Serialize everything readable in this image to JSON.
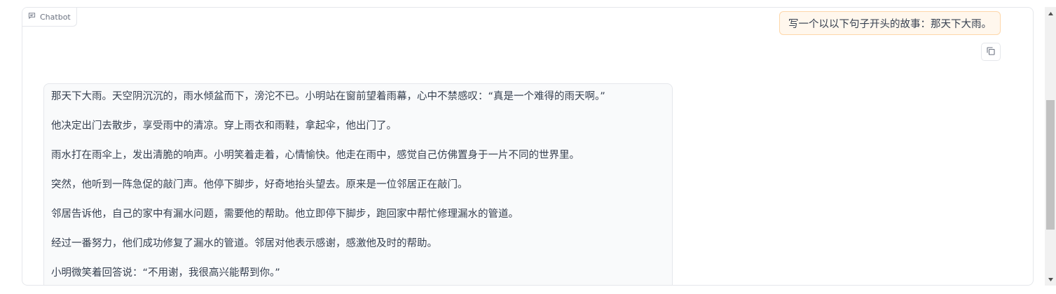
{
  "chatbot": {
    "label": "Chatbot",
    "label_icon": "chat-icon"
  },
  "conversation": {
    "user_message": "写一个以以下句子开头的故事：那天下大雨。",
    "copy_icon": "copy-icon",
    "bot_paragraphs": [
      "那天下大雨。天空阴沉沉的，雨水倾盆而下，滂沱不已。小明站在窗前望着雨幕，心中不禁感叹：“真是一个难得的雨天啊。”",
      "他决定出门去散步，享受雨中的清凉。穿上雨衣和雨鞋，拿起伞，他出门了。",
      "雨水打在雨伞上，发出清脆的响声。小明笑着走着，心情愉快。他走在雨中，感觉自己仿佛置身于一片不同的世界里。",
      "突然，他听到一阵急促的敲门声。他停下脚步，好奇地抬头望去。原来是一位邻居正在敲门。",
      "邻居告诉他，自己的家中有漏水问题，需要他的帮助。他立即停下脚步，跑回家中帮忙修理漏水的管道。",
      "经过一番努力，他们成功修复了漏水的管道。邻居对他表示感谢，感激他及时的帮助。",
      "小明微笑着回答说：“不用谢，我很高兴能帮到你。”"
    ]
  },
  "scrollbar": {
    "up_icon": "scroll-up-arrow-icon",
    "down_icon": "scroll-down-arrow-icon"
  }
}
